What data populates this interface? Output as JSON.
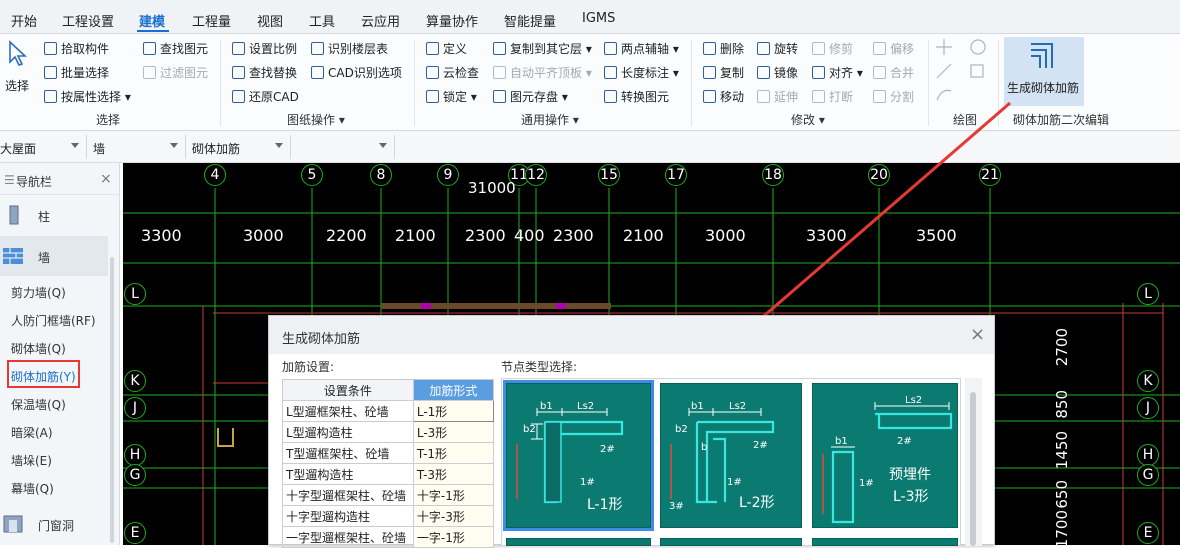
{
  "menubar": {
    "tabs": [
      "开始",
      "工程设置",
      "建模",
      "工程量",
      "视图",
      "工具",
      "云应用",
      "算量协作",
      "智能提量",
      "IGMS"
    ],
    "active_tab": "建模"
  },
  "ribbon": {
    "select_group": {
      "big": "选择",
      "pick": "拾取构件",
      "batch": "批量选择",
      "by_prop": "按属性选择",
      "find": "查找图元",
      "filter": "过滤图元",
      "label": "选择"
    },
    "drawing_group": {
      "scale": "设置比例",
      "find_replace": "查找替换",
      "restore": "还原CAD",
      "floor": "识别楼层表",
      "cad_options": "CAD识别选项",
      "label": "图纸操作"
    },
    "general_group": {
      "define": "定义",
      "cloud_check": "云检查",
      "lock": "锁定",
      "copy_layer": "复制到其它层",
      "auto_flat": "自动平齐顶板",
      "store": "图元存盘",
      "two_pt": "两点辅轴",
      "length_mark": "长度标注",
      "convert": "转换图元",
      "label": "通用操作"
    },
    "modify_group": {
      "delete": "删除",
      "copy": "复制",
      "move": "移动",
      "rotate": "旋转",
      "mirror": "镜像",
      "extend": "延伸",
      "trim": "修剪",
      "align": "对齐",
      "break": "打断",
      "offset": "偏移",
      "merge": "合并",
      "split": "分割",
      "label": "修改"
    },
    "draw_group": {
      "label": "绘图"
    },
    "rebar_group": {
      "button": "生成砌体加筋",
      "label": "砌体加筋二次编辑"
    }
  },
  "toolbar2": {
    "floor": "大屋面",
    "type": "墙",
    "sub": "砌体加筋"
  },
  "nav": {
    "title": "导航栏",
    "close": "×",
    "cat_column": "柱",
    "cat_wall": "墙",
    "items": [
      "剪力墙(Q)",
      "人防门框墙(RF)",
      "砌体墙(Q)",
      "砌体加筋(Y)",
      "保温墙(Q)",
      "暗梁(A)",
      "墙垛(E)",
      "幕墙(Q)"
    ],
    "selected_item": "砌体加筋(Y)",
    "cat_door": "门窗洞"
  },
  "canvas": {
    "axes_top": [
      "4",
      "5",
      "8",
      "9",
      "11",
      "12",
      "15",
      "17",
      "18",
      "20",
      "21"
    ],
    "total_dim": "31000",
    "dims": [
      "3300",
      "3000",
      "2200",
      "2100",
      "2300",
      "400",
      "2300",
      "2100",
      "3000",
      "3300",
      "3500"
    ],
    "rows_left": [
      "L",
      "K",
      "J",
      "H",
      "G",
      "E"
    ],
    "rows_right": [
      "L",
      "K",
      "J",
      "H",
      "G",
      "E"
    ],
    "vertical_dims": [
      "2700",
      "850",
      "1450",
      "650",
      "1700"
    ]
  },
  "dialog": {
    "title": "生成砌体加筋",
    "close": "×",
    "left_label": "加筋设置:",
    "right_label": "节点类型选择:",
    "headers": [
      "设置条件",
      "加筋形式"
    ],
    "rows": [
      {
        "cond": "L型遛框架柱、砼墙",
        "form": "L-1形"
      },
      {
        "cond": "L型遛构造柱",
        "form": "L-3形"
      },
      {
        "cond": "T型遛框架柱、砼墙",
        "form": "T-1形"
      },
      {
        "cond": "T型遛构造柱",
        "form": "T-3形"
      },
      {
        "cond": "十字型遛框架柱、砼墙",
        "form": "十字-1形"
      },
      {
        "cond": "十字型遛构造柱",
        "form": "十字-3形"
      },
      {
        "cond": "一字型遛框架柱、砼墙",
        "form": "一字-1形"
      }
    ],
    "nodes": [
      {
        "name": "L-1形",
        "b1": "b1",
        "ls2": "Ls2",
        "b2": "b2",
        "r2": "2#",
        "r1": "1#",
        "selected": true
      },
      {
        "name": "L-2形",
        "b1": "b1",
        "ls2": "Ls2",
        "b2": "b2",
        "r2": "2#",
        "r1": "1#",
        "r3": "3#",
        "b": "b",
        "selected": false
      },
      {
        "name": "L-3形",
        "pre": "预埋件",
        "b1": "b1",
        "ls2": "Ls2",
        "r2": "2#",
        "r1": "1#",
        "selected": false
      }
    ]
  },
  "colors": {
    "accent": "#1a6fd0",
    "cad_bg": "#000000",
    "grid_green": "#1fae1f",
    "node_teal": "#0b7b72",
    "highlight_red": "#e53935"
  }
}
